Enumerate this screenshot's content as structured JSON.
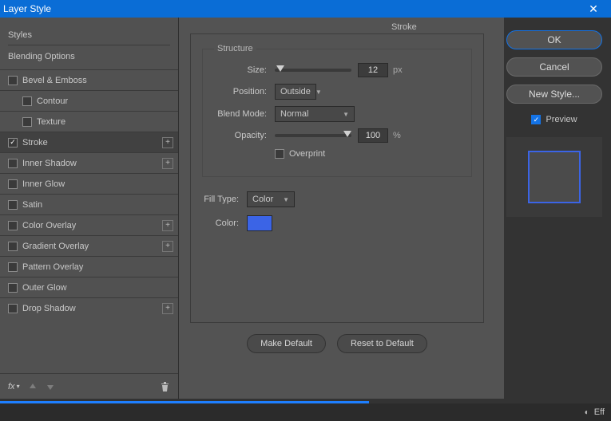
{
  "window": {
    "title": "Layer Style"
  },
  "sidebar": {
    "styles_label": "Styles",
    "blending_label": "Blending Options",
    "effects": [
      {
        "label": "Bevel & Emboss",
        "checked": false,
        "indent": false,
        "plus": false
      },
      {
        "label": "Contour",
        "checked": false,
        "indent": true,
        "plus": false
      },
      {
        "label": "Texture",
        "checked": false,
        "indent": true,
        "plus": false
      },
      {
        "label": "Stroke",
        "checked": true,
        "indent": false,
        "plus": true,
        "selected": true
      },
      {
        "label": "Inner Shadow",
        "checked": false,
        "indent": false,
        "plus": true
      },
      {
        "label": "Inner Glow",
        "checked": false,
        "indent": false,
        "plus": false
      },
      {
        "label": "Satin",
        "checked": false,
        "indent": false,
        "plus": false
      },
      {
        "label": "Color Overlay",
        "checked": false,
        "indent": false,
        "plus": true
      },
      {
        "label": "Gradient Overlay",
        "checked": false,
        "indent": false,
        "plus": true
      },
      {
        "label": "Pattern Overlay",
        "checked": false,
        "indent": false,
        "plus": false
      },
      {
        "label": "Outer Glow",
        "checked": false,
        "indent": false,
        "plus": false
      },
      {
        "label": "Drop Shadow",
        "checked": false,
        "indent": false,
        "plus": true
      }
    ],
    "fx_label": "fx"
  },
  "panel": {
    "title": "Stroke",
    "structure_legend": "Structure",
    "size_label": "Size:",
    "size_value": "12",
    "size_unit": "px",
    "position_label": "Position:",
    "position_value": "Outside",
    "blendmode_label": "Blend Mode:",
    "blendmode_value": "Normal",
    "opacity_label": "Opacity:",
    "opacity_value": "100",
    "opacity_unit": "%",
    "overprint_label": "Overprint",
    "filltype_label": "Fill Type:",
    "filltype_value": "Color",
    "color_label": "Color:",
    "color_value": "#3b64e6",
    "make_default": "Make Default",
    "reset_default": "Reset to Default"
  },
  "right": {
    "ok": "OK",
    "cancel": "Cancel",
    "new_style": "New Style...",
    "preview_label": "Preview"
  },
  "bottom": {
    "eff": "Eff"
  }
}
